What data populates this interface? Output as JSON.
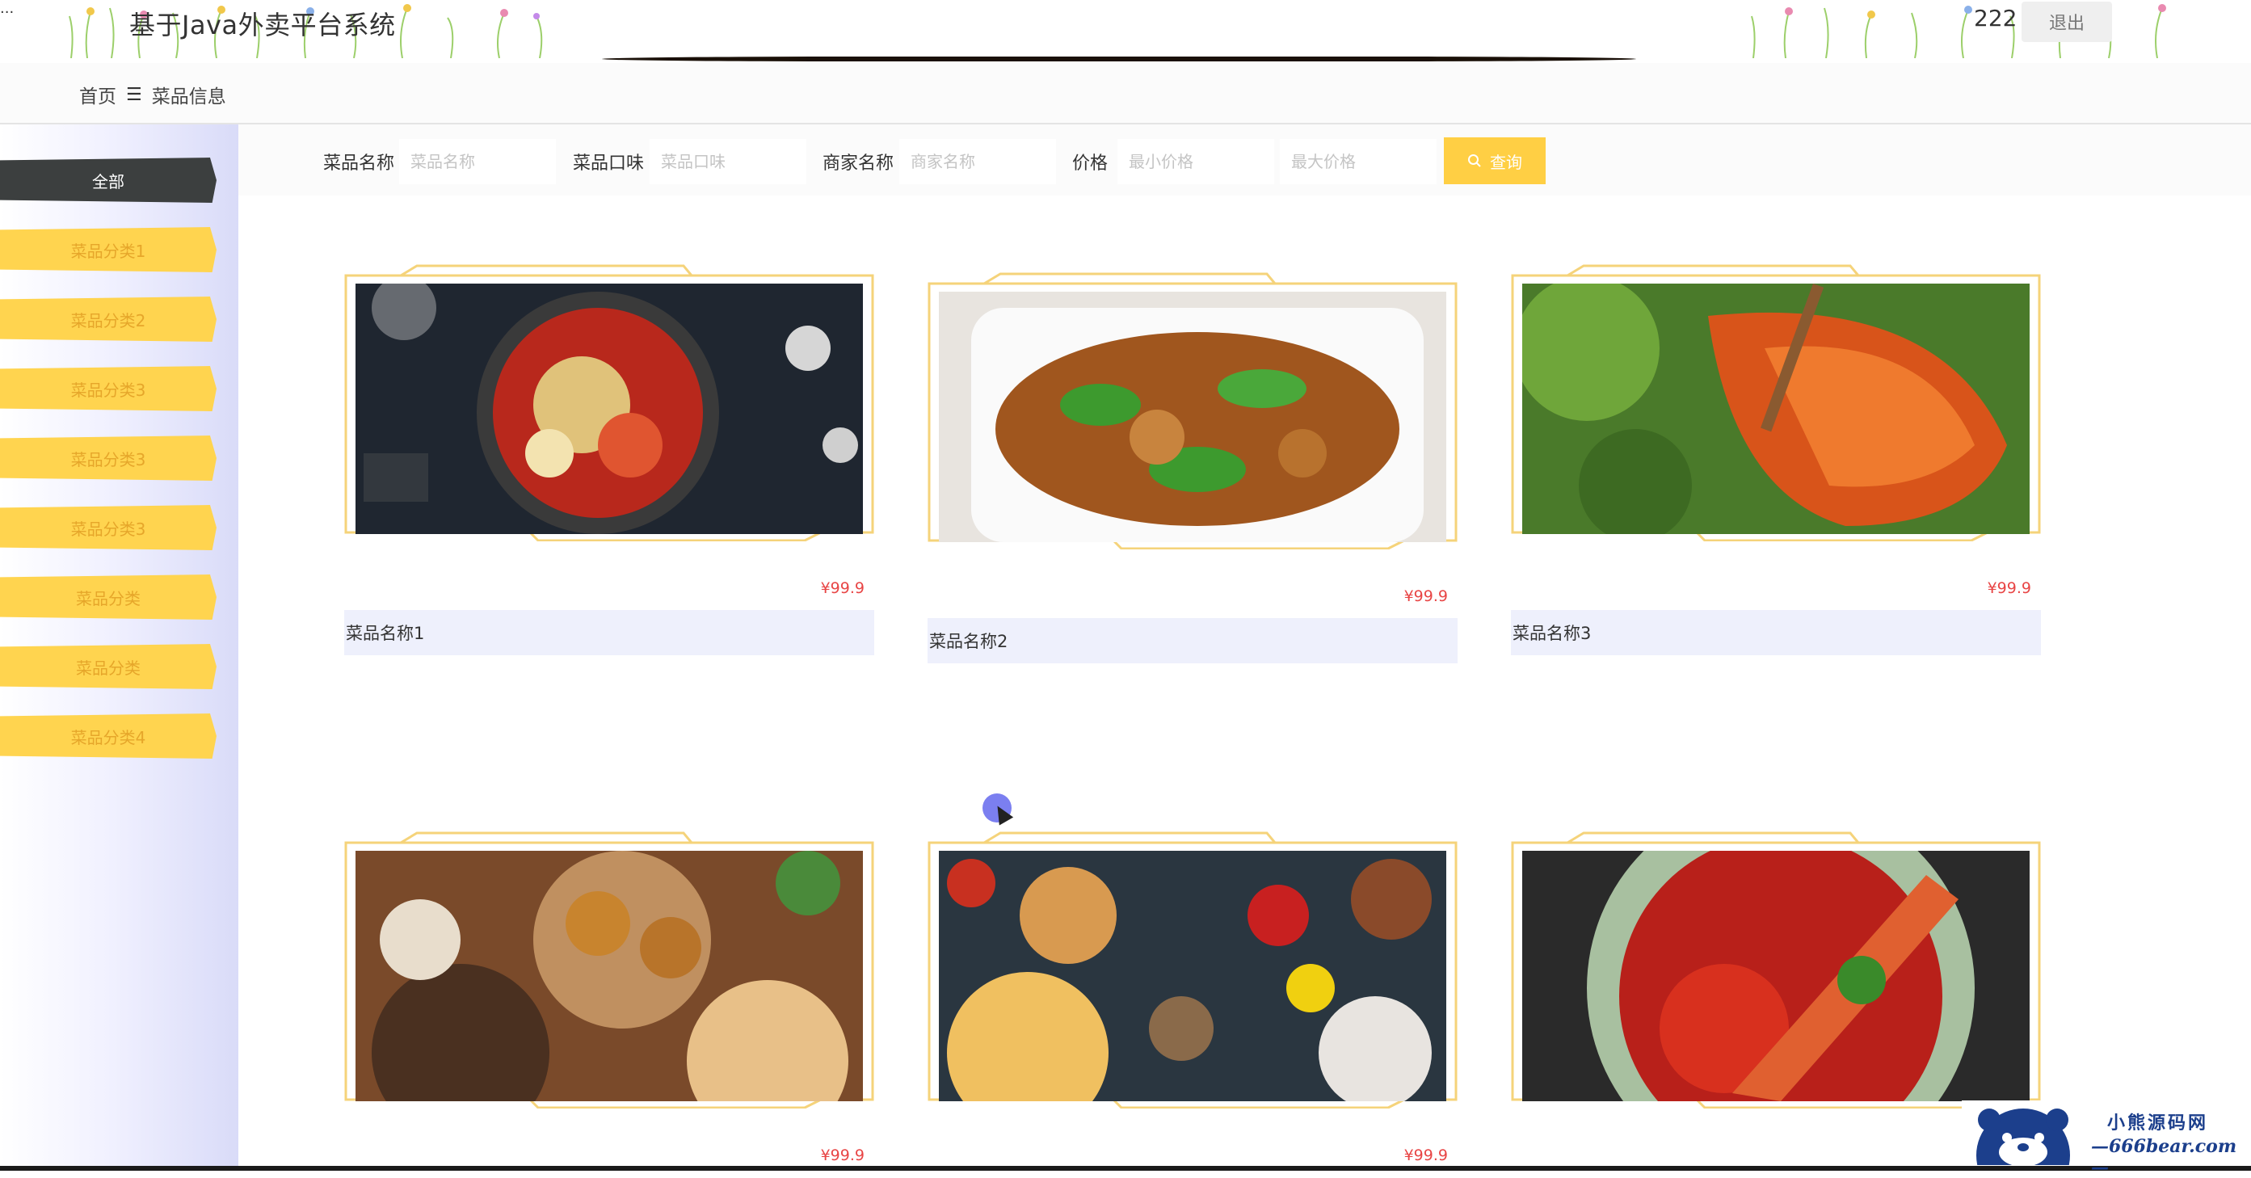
{
  "header": {
    "app_title": "基于Java外卖平台系统",
    "user_name": "222",
    "logout_label": "退出",
    "corner_mark": "..."
  },
  "breadcrumb": {
    "home": "首页",
    "separator_icon": "menu-icon",
    "current": "菜品信息"
  },
  "sidebar": {
    "categories": [
      {
        "label": "全部",
        "active": true
      },
      {
        "label": "菜品分类1",
        "active": false
      },
      {
        "label": "菜品分类2",
        "active": false
      },
      {
        "label": "菜品分类3",
        "active": false
      },
      {
        "label": "菜品分类3",
        "active": false
      },
      {
        "label": "菜品分类3",
        "active": false
      },
      {
        "label": "菜品分类",
        "active": false
      },
      {
        "label": "菜品分类",
        "active": false
      },
      {
        "label": "菜品分类4",
        "active": false
      }
    ]
  },
  "search": {
    "fields": [
      {
        "label": "菜品名称",
        "placeholder": "菜品名称",
        "value": ""
      },
      {
        "label": "菜品口味",
        "placeholder": "菜品口味",
        "value": ""
      },
      {
        "label": "商家名称",
        "placeholder": "商家名称",
        "value": ""
      },
      {
        "label": "价格",
        "placeholder": "最小价格",
        "value": ""
      },
      {
        "label": "",
        "placeholder": "最大价格",
        "value": ""
      }
    ],
    "button_label": "查询",
    "button_icon": "search-icon"
  },
  "products": [
    {
      "name": "菜品名称1",
      "price": "¥99.9",
      "image": "hotpot-fish"
    },
    {
      "name": "菜品名称2",
      "price": "¥99.9",
      "image": "chicken-pepper"
    },
    {
      "name": "菜品名称3",
      "price": "¥99.9",
      "image": "spicy-shrimp"
    },
    {
      "name": "",
      "price": "¥99.9",
      "image": "bread-feast"
    },
    {
      "name": "",
      "price": "¥99.9",
      "image": "mixed-feast"
    },
    {
      "name": "",
      "price": "",
      "image": "crayfish-chili"
    }
  ],
  "watermark": {
    "line1": "小熊源码网",
    "line2": "—666bear.com—"
  },
  "colors": {
    "accent_yellow": "#ffd44f",
    "active_dark": "#3c3f3f",
    "price_red": "#e84545",
    "frame_gold": "#f5d37a"
  }
}
